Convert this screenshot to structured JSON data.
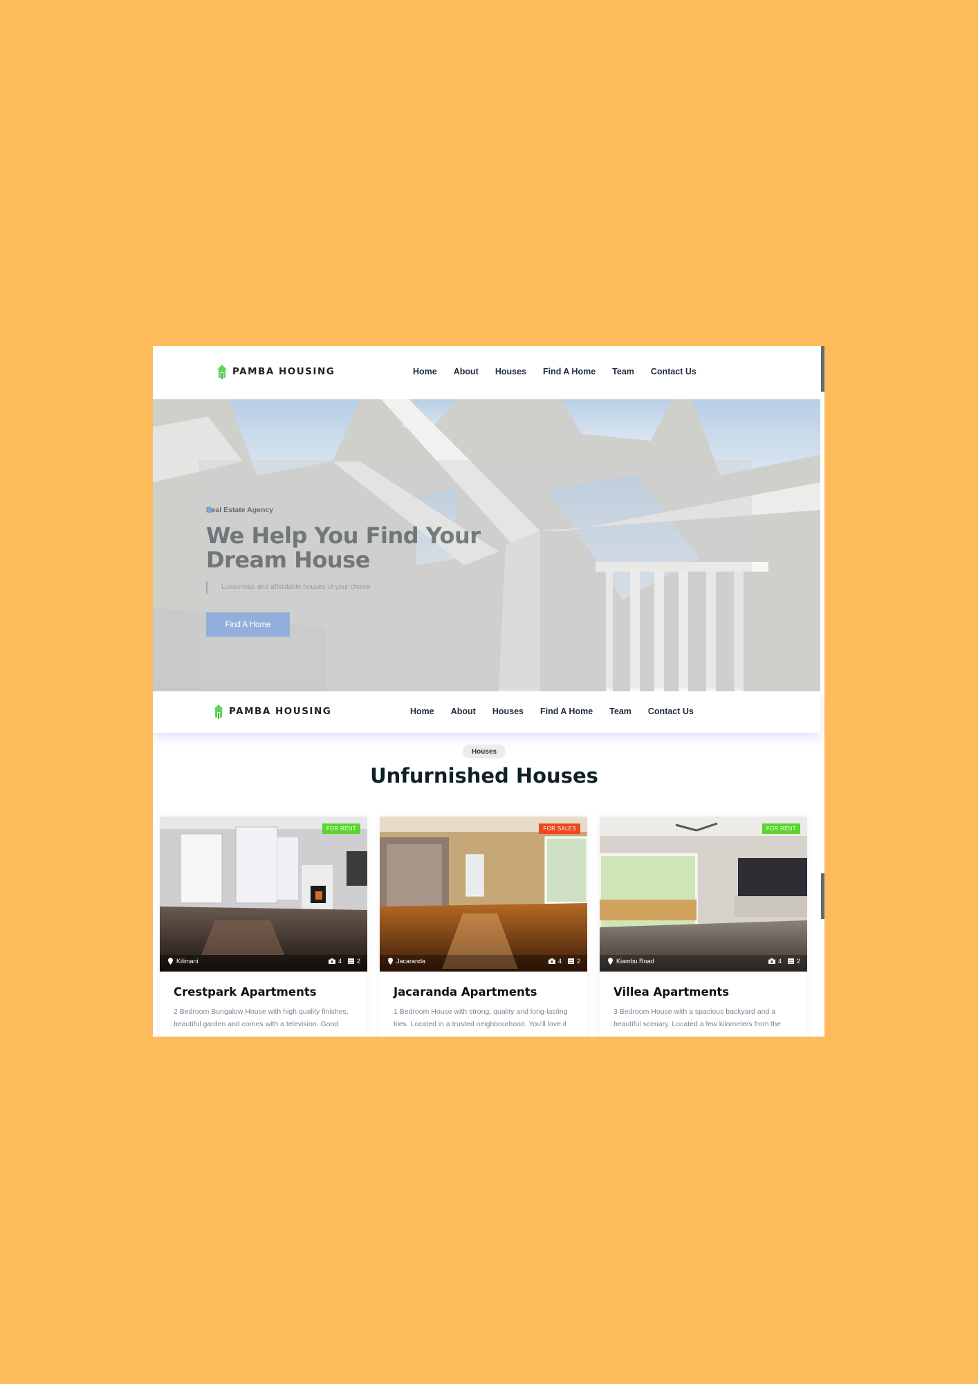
{
  "brand": {
    "name": "PAMBA HOUSING",
    "icon": "house-tree-icon"
  },
  "nav": [
    "Home",
    "About",
    "Houses",
    "Find A Home",
    "Team",
    "Contact Us"
  ],
  "hero": {
    "tag": "Real Estate Agency",
    "title": "We Help You Find Your Dream House",
    "subtitle": "Luxourious and affordable houses of your choice",
    "button": "Find A Home"
  },
  "section": {
    "pill": "Houses",
    "title": "Unfurnished Houses"
  },
  "cards": [
    {
      "badge": "FOR RENT",
      "badge_color": "#58d62b",
      "location": "Kilimani",
      "photos": "4",
      "rooms": "2",
      "title": "Crestpark Apartments",
      "desc": "2 Bedroom Bungalow House with high quality finishes, beautiful garden and comes with a television. Good"
    },
    {
      "badge": "FOR SALES",
      "badge_color": "#f0461b",
      "location": "Jacaranda",
      "photos": "4",
      "rooms": "2",
      "title": "Jacaranda Apartments",
      "desc": "1 Bedroom House with strong, quality and long-lasting tiles. Located in a trusted neighbourhood. You'll love it"
    },
    {
      "badge": "FOR RENT",
      "badge_color": "#58d62b",
      "location": "Kiambu Road",
      "photos": "4",
      "rooms": "2",
      "title": "Villea Apartments",
      "desc": "3 Bedroom House with a spacious backyard and a beautiful scenary. Located a few kilometers from the"
    }
  ],
  "colors": {
    "background": "#FEBB5B",
    "accent": "#92afdb",
    "brand_green": "#5fd35a"
  }
}
